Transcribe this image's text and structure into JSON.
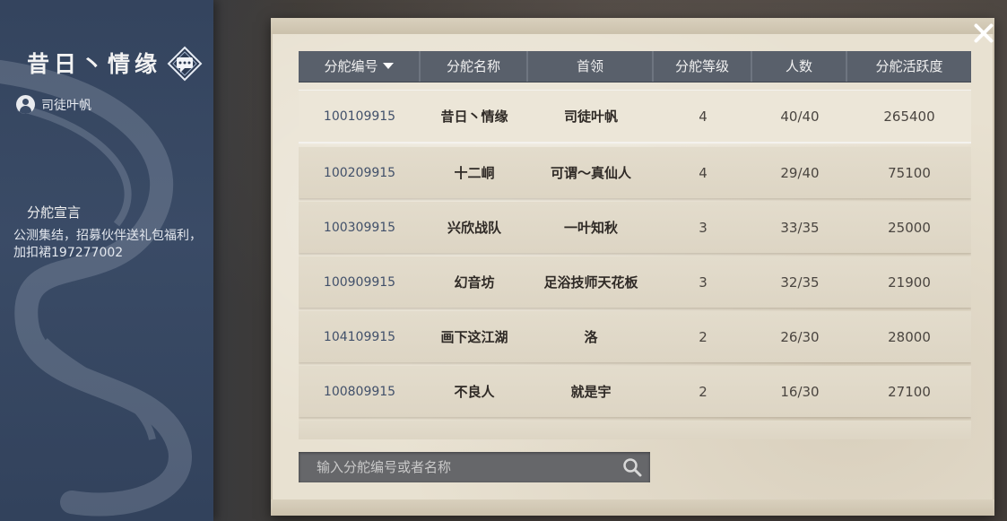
{
  "side": {
    "guild_name": "昔日丶情缘",
    "leader_name": "司徒叶帆",
    "declaration_title": "分舵宣言",
    "declaration_text": "公测集结，招募伙伴送礼包福利，加扣裙197277002",
    "chat_icon": "chat-icon"
  },
  "table": {
    "headers": [
      "分舵编号",
      "分舵名称",
      "首领",
      "分舵等级",
      "人数",
      "分舵活跃度"
    ],
    "sorted_by": "分舵编号",
    "rows": [
      {
        "id": "100109915",
        "name": "昔日丶情缘",
        "leader": "司徒叶帆",
        "level": "4",
        "members": "40/40",
        "activity": "265400"
      },
      {
        "id": "100209915",
        "name": "十二峒",
        "leader": "可谓～真仙人",
        "level": "4",
        "members": "29/40",
        "activity": "75100"
      },
      {
        "id": "100309915",
        "name": "兴欣战队",
        "leader": "一叶知秋",
        "level": "3",
        "members": "33/35",
        "activity": "25000"
      },
      {
        "id": "100909915",
        "name": "幻音坊",
        "leader": "足浴技师天花板",
        "level": "3",
        "members": "32/35",
        "activity": "21900"
      },
      {
        "id": "104109915",
        "name": "画下这江湖",
        "leader": "洛",
        "level": "2",
        "members": "26/30",
        "activity": "28000"
      },
      {
        "id": "100809915",
        "name": "不良人",
        "leader": "就是宇",
        "level": "2",
        "members": "16/30",
        "activity": "27100"
      }
    ]
  },
  "search": {
    "placeholder": "输入分舵编号或者名称"
  },
  "colors": {
    "side_panel": "#3a4b66",
    "header_bar": "#59606b",
    "parchment": "#e8e1d1",
    "id_text": "#41506a"
  }
}
